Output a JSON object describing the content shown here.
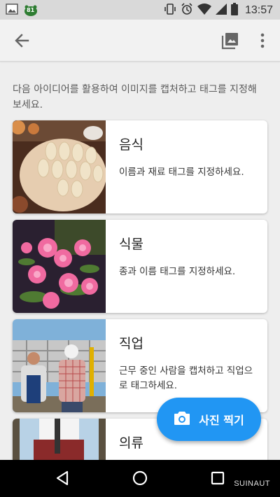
{
  "status_bar": {
    "time": "13:57",
    "badge": "81",
    "icons": [
      "image-notification-icon",
      "battery-saver-badge-icon",
      "vibrate-icon",
      "alarm-icon",
      "wifi-icon",
      "signal-icon",
      "battery-icon"
    ]
  },
  "app_bar": {
    "icons": [
      "back-arrow-icon",
      "gallery-icon",
      "more-vert-icon"
    ]
  },
  "intro": "다음 아이디어를 활용하여 이미지를 캡처하고 태그를 지정해 보세요.",
  "cards": [
    {
      "title": "음식",
      "description": "이름과 재료 태그를 지정하세요.",
      "thumbnail": "dumplings-photo"
    },
    {
      "title": "식물",
      "description": "종과 이름 태그를 지정하세요.",
      "thumbnail": "pink-flowers-photo"
    },
    {
      "title": "직업",
      "description": "근무 중인 사람을 캡처하고 직업으로 태그하세요.",
      "thumbnail": "construction-workers-photo"
    },
    {
      "title": "의류",
      "description": "",
      "thumbnail": "clothing-photo"
    }
  ],
  "fab": {
    "label": "사진 찍기",
    "icon": "camera-icon"
  },
  "nav_bar": {
    "icons": [
      "nav-back-icon",
      "nav-home-icon",
      "nav-recent-icon"
    ],
    "watermark": "SUINAUT"
  },
  "colors": {
    "accent": "#2196f3",
    "status_bar": "#d9d9d9",
    "app_bar": "#f2f2f2",
    "background": "#eeeeee",
    "nav_bar": "#000000"
  }
}
